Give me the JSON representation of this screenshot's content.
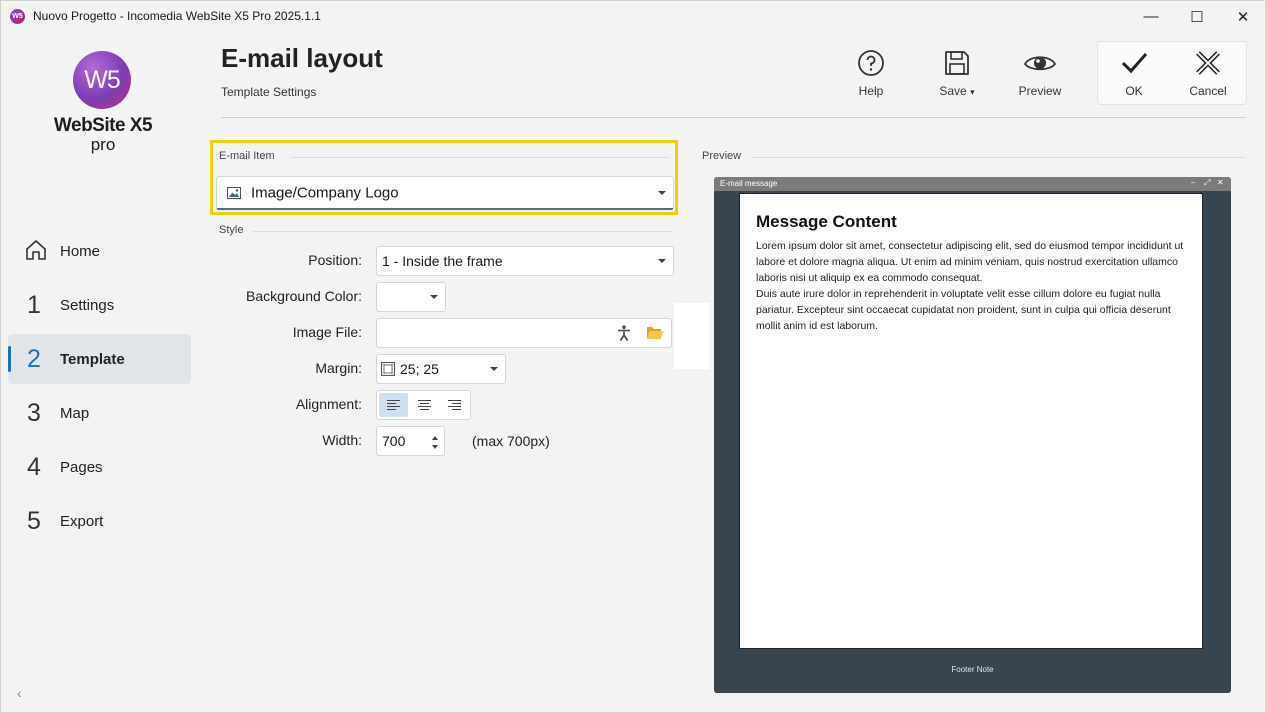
{
  "window": {
    "title": "Nuovo Progetto - Incomedia WebSite X5 Pro 2025.1.1",
    "app_icon_text": "W5",
    "minimize": "—",
    "maximize": "☐",
    "close": "✕"
  },
  "logo": {
    "mark": "W5",
    "name": "WebSite X5",
    "edition": "pro"
  },
  "sidebar": {
    "items": [
      {
        "num": "",
        "label": "Home"
      },
      {
        "num": "1",
        "label": "Settings"
      },
      {
        "num": "2",
        "label": "Template"
      },
      {
        "num": "3",
        "label": "Map"
      },
      {
        "num": "4",
        "label": "Pages"
      },
      {
        "num": "5",
        "label": "Export"
      }
    ],
    "active": "Template",
    "collapse_icon": "‹"
  },
  "header": {
    "title": "E-mail layout",
    "subtitle": "Template Settings",
    "toolbar": {
      "help": "Help",
      "save": "Save",
      "save_caret": "▾",
      "preview": "Preview",
      "ok": "OK",
      "cancel": "Cancel"
    }
  },
  "email_item": {
    "group_label": "E-mail Item",
    "selected": "Image/Company Logo"
  },
  "style": {
    "group_label": "Style",
    "position": {
      "label": "Position:",
      "value": "1 - Inside the frame"
    },
    "background_color": {
      "label": "Background Color:",
      "value": ""
    },
    "image_file": {
      "label": "Image File:",
      "value": ""
    },
    "margin": {
      "label": "Margin:",
      "value": "25; 25"
    },
    "alignment": {
      "label": "Alignment:",
      "selected": "left",
      "options": [
        "left",
        "center",
        "right"
      ]
    },
    "width": {
      "label": "Width:",
      "value": "700",
      "hint": "(max 700px)"
    }
  },
  "preview": {
    "group_label": "Preview",
    "window_title": "E-mail message",
    "window_controls": [
      "–",
      "⤢",
      "✕"
    ],
    "content_title": "Message Content",
    "paragraph1": "Lorem ipsum dolor sit amet, consectetur adipiscing elit, sed do eiusmod tempor incididunt ut labore et dolore magna aliqua. Ut enim ad minim veniam, quis nostrud exercitation ullamco laboris nisi ut aliquip ex ea commodo consequat.",
    "paragraph2": "Duis aute irure dolor in reprehenderit in voluptate velit esse cillum dolore eu fugiat nulla pariatur. Excepteur sint occaecat cupidatat non proident, sunt in culpa qui officia deserunt mollit anim id est laborum.",
    "footer": "Footer Note"
  },
  "colors": {
    "accent": "#1f6fb2",
    "highlight": "#f0d000",
    "preview_bg": "#36454f"
  }
}
